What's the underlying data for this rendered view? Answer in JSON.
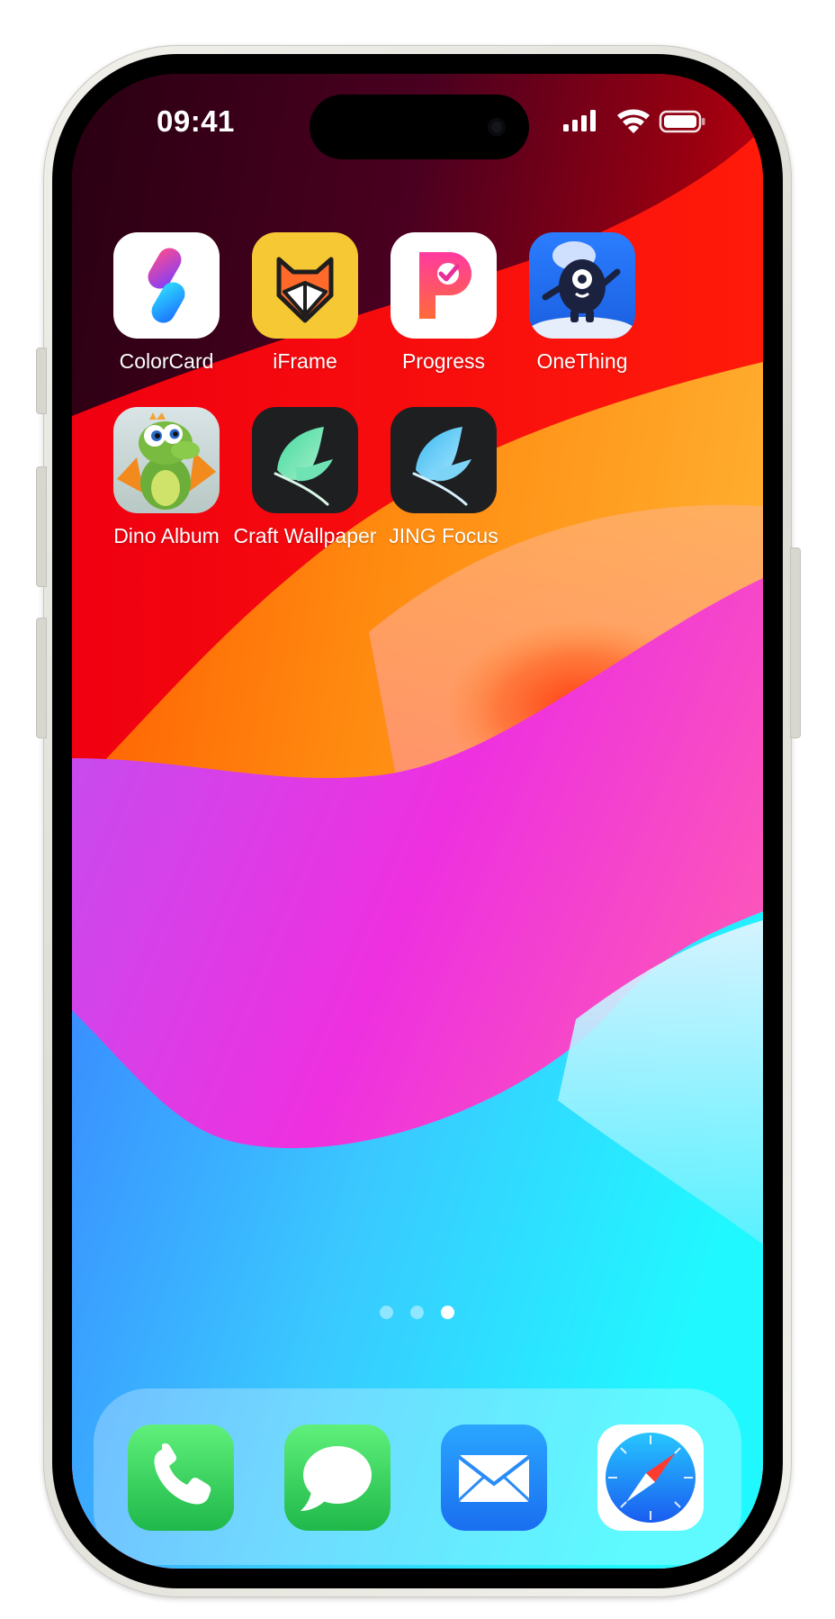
{
  "status_bar": {
    "time": "09:41"
  },
  "apps": [
    {
      "name": "ColorCard",
      "icon": "colorcard-icon"
    },
    {
      "name": "iFrame",
      "icon": "iframe-fox-icon"
    },
    {
      "name": "Progress",
      "icon": "progress-icon"
    },
    {
      "name": "OneThing",
      "icon": "onething-icon"
    },
    {
      "name": "Dino Album",
      "icon": "dino-album-icon"
    },
    {
      "name": "Craft Wallpaper",
      "icon": "craft-wallpaper-icon"
    },
    {
      "name": "JING Focus",
      "icon": "jing-focus-icon"
    }
  ],
  "page_indicator": {
    "pages": 3,
    "current_page": 3
  },
  "dock": [
    {
      "app": "Phone",
      "icon": "phone-icon",
      "color": "#34c759"
    },
    {
      "app": "Messages",
      "icon": "messages-icon",
      "color": "#34c759"
    },
    {
      "app": "Mail",
      "icon": "mail-icon",
      "color": "#1a8cff"
    },
    {
      "app": "Safari",
      "icon": "safari-compass-icon",
      "color": "#1a7cf2"
    }
  ]
}
